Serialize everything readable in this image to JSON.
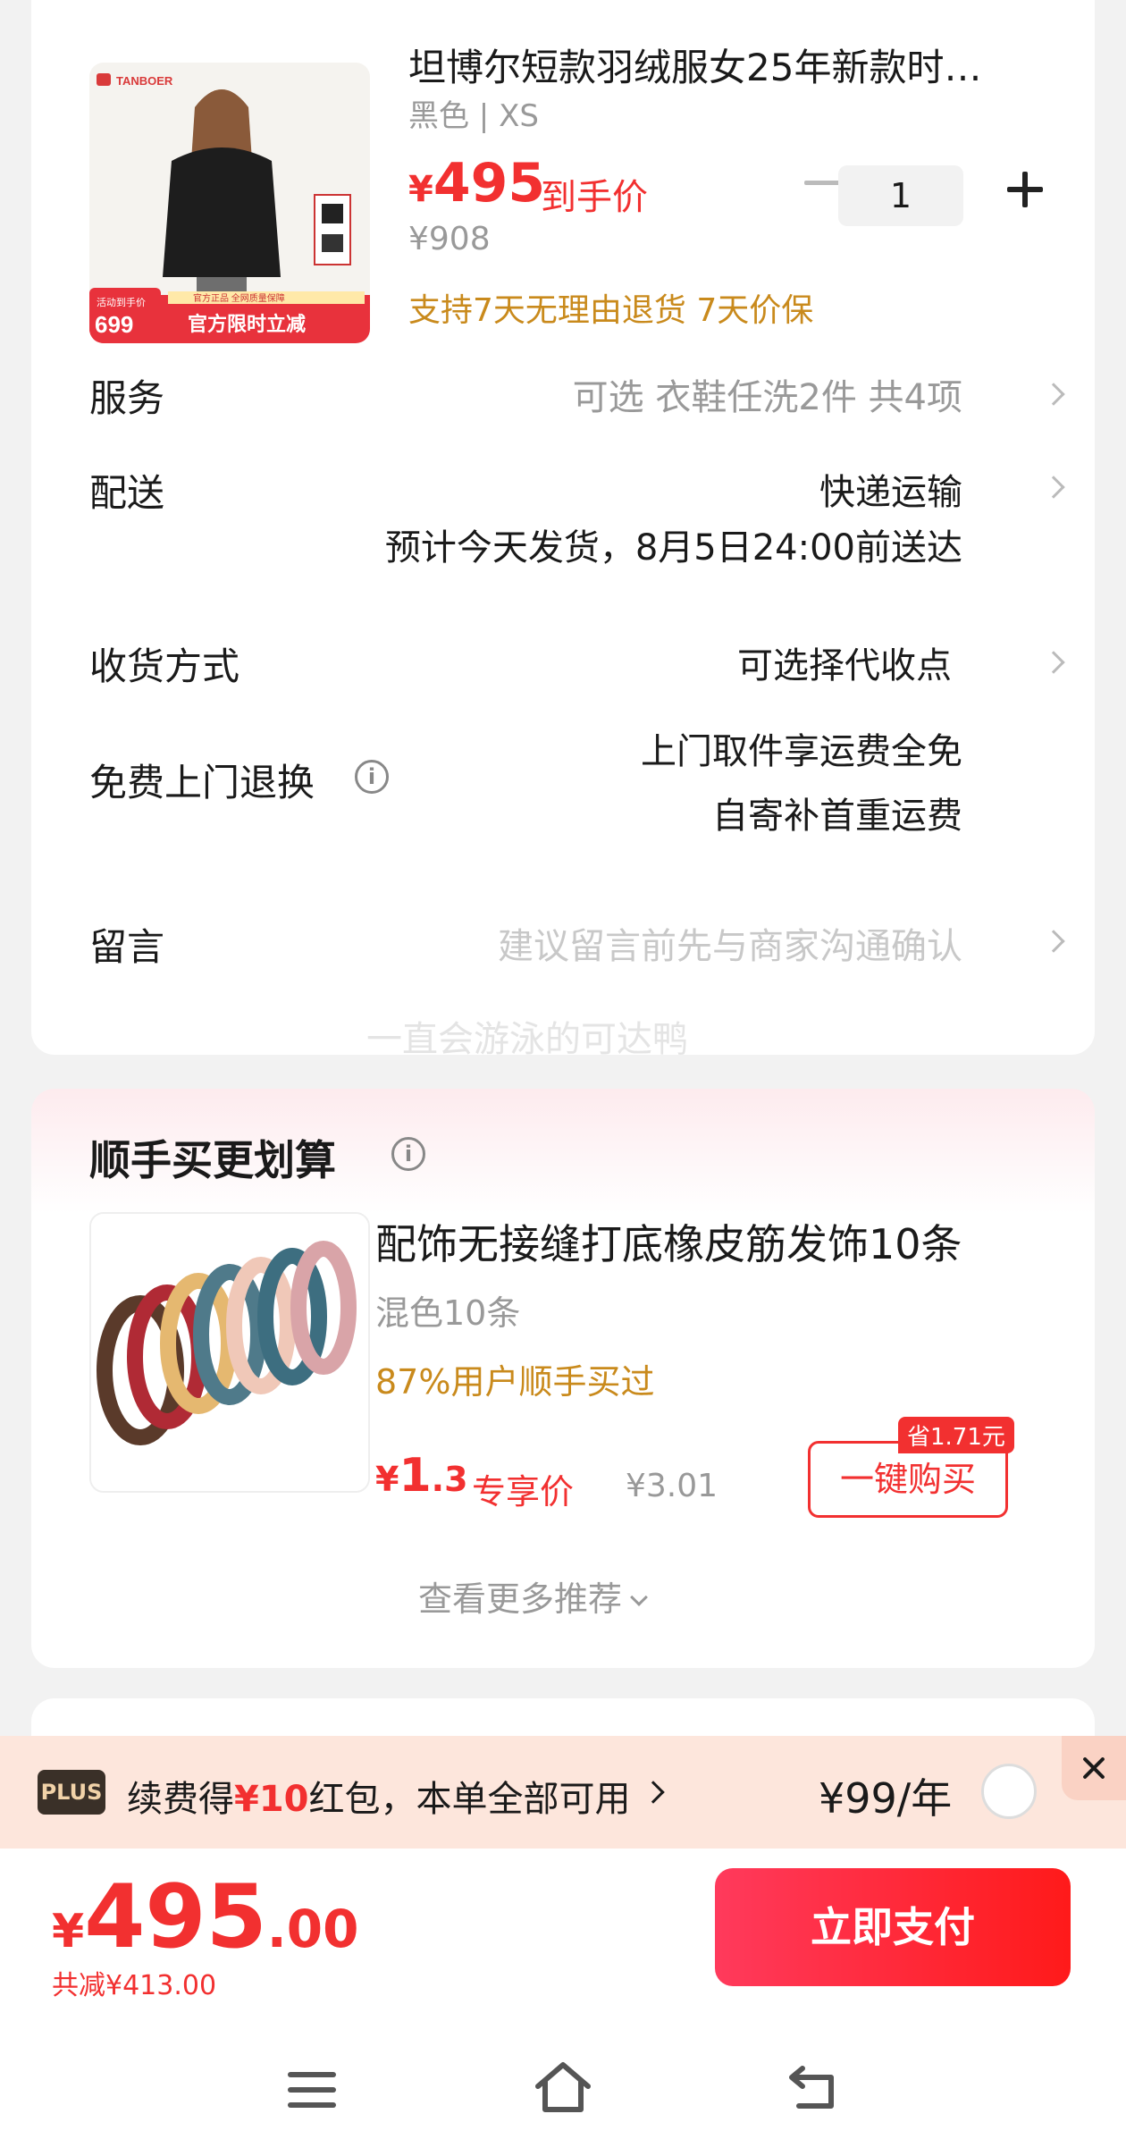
{
  "product": {
    "title": "坦博尔短款羽绒服女25年新款时…",
    "spec": "黑色 | XS",
    "price_currency": "¥",
    "price": "495",
    "price_tag": "到手价",
    "original_price": "¥908",
    "guarantee": "支持7天无理由退货  7天价保",
    "quantity": "1",
    "image": {
      "brand": "TANBOER",
      "badge_top": "活动到手价",
      "badge_price": "699",
      "banner_small": "官方正品 全网质量保障",
      "banner_main": "官方限时立减"
    }
  },
  "rows": {
    "service": {
      "label": "服务",
      "value": "可选 衣鞋任洗2件 共4项"
    },
    "delivery": {
      "label": "配送",
      "value": "快递运输",
      "sub": "预计今天发货，8月5日24:00前送达"
    },
    "receive": {
      "label": "收货方式",
      "value": "可选择代收点"
    },
    "return": {
      "label": "免费上门退换",
      "line1": "上门取件享运费全免",
      "line2": "自寄补首重运费"
    },
    "message": {
      "label": "留言",
      "placeholder": "建议留言前先与商家沟通确认"
    }
  },
  "watermark": "一直会游泳的可达鸭",
  "recommend": {
    "title": "顺手买更划算",
    "item": {
      "name": "配饰无接缝打底橡皮筋发饰10条",
      "spec": "混色10条",
      "stat": "87%用户顺手买过",
      "price_currency": "¥",
      "price_int": "1",
      "price_dec": ".3",
      "price_tag": "专享价",
      "original_price": "¥3.01",
      "save_badge": "省1.71元",
      "buy_label": "一键购买"
    },
    "more_label": "查看更多推荐"
  },
  "plus": {
    "badge": "PLUS",
    "text_prefix": "续费得",
    "text_amount": "¥10",
    "text_suffix": "红包，本单全部可用",
    "price": "¥99/年"
  },
  "footer": {
    "total_currency": "¥",
    "total_int": "495",
    "total_dec": ".00",
    "discount": "共减¥413.00",
    "pay_label": "立即支付"
  },
  "colors": {
    "accent": "#f23030",
    "gold": "#c98a1c",
    "plus_bg": "#fde6dc"
  }
}
